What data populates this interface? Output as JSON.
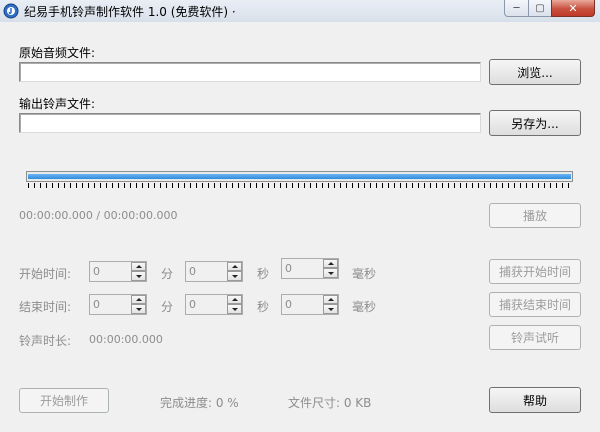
{
  "window": {
    "title": "纪易手机铃声制作软件 1.0 (免费软件)",
    "title_suffix": "·",
    "controls": {
      "minimize": "─",
      "maximize": "▢",
      "close": "✕"
    }
  },
  "source": {
    "label": "原始音频文件:",
    "value": "",
    "browse_label": "浏览..."
  },
  "output": {
    "label": "输出铃声文件:",
    "value": "",
    "save_as_label": "另存为..."
  },
  "player": {
    "position_text": "00:00:00.000 / 00:00:00.000",
    "play_label": "播放",
    "progress": 0
  },
  "start_time": {
    "label": "开始时间:",
    "minutes": "0",
    "minutes_unit": "分",
    "seconds": "0",
    "seconds_unit": "秒",
    "milliseconds": "0",
    "milliseconds_unit": "毫秒",
    "capture_label": "捕获开始时间"
  },
  "end_time": {
    "label": "结束时间:",
    "minutes": "0",
    "minutes_unit": "分",
    "seconds": "0",
    "seconds_unit": "秒",
    "milliseconds": "0",
    "milliseconds_unit": "毫秒",
    "capture_label": "捕获结束时间"
  },
  "duration": {
    "label": "铃声时长:",
    "value": "00:00:00.000",
    "preview_label": "铃声试听"
  },
  "footer": {
    "start_label": "开始制作",
    "progress_text": "完成进度: 0 %",
    "size_text": "文件尺寸: 0 KB",
    "help_label": "帮助"
  },
  "colors": {
    "slider_fill": "#2d8ce0",
    "disabled_text": "#8d8d8d"
  }
}
